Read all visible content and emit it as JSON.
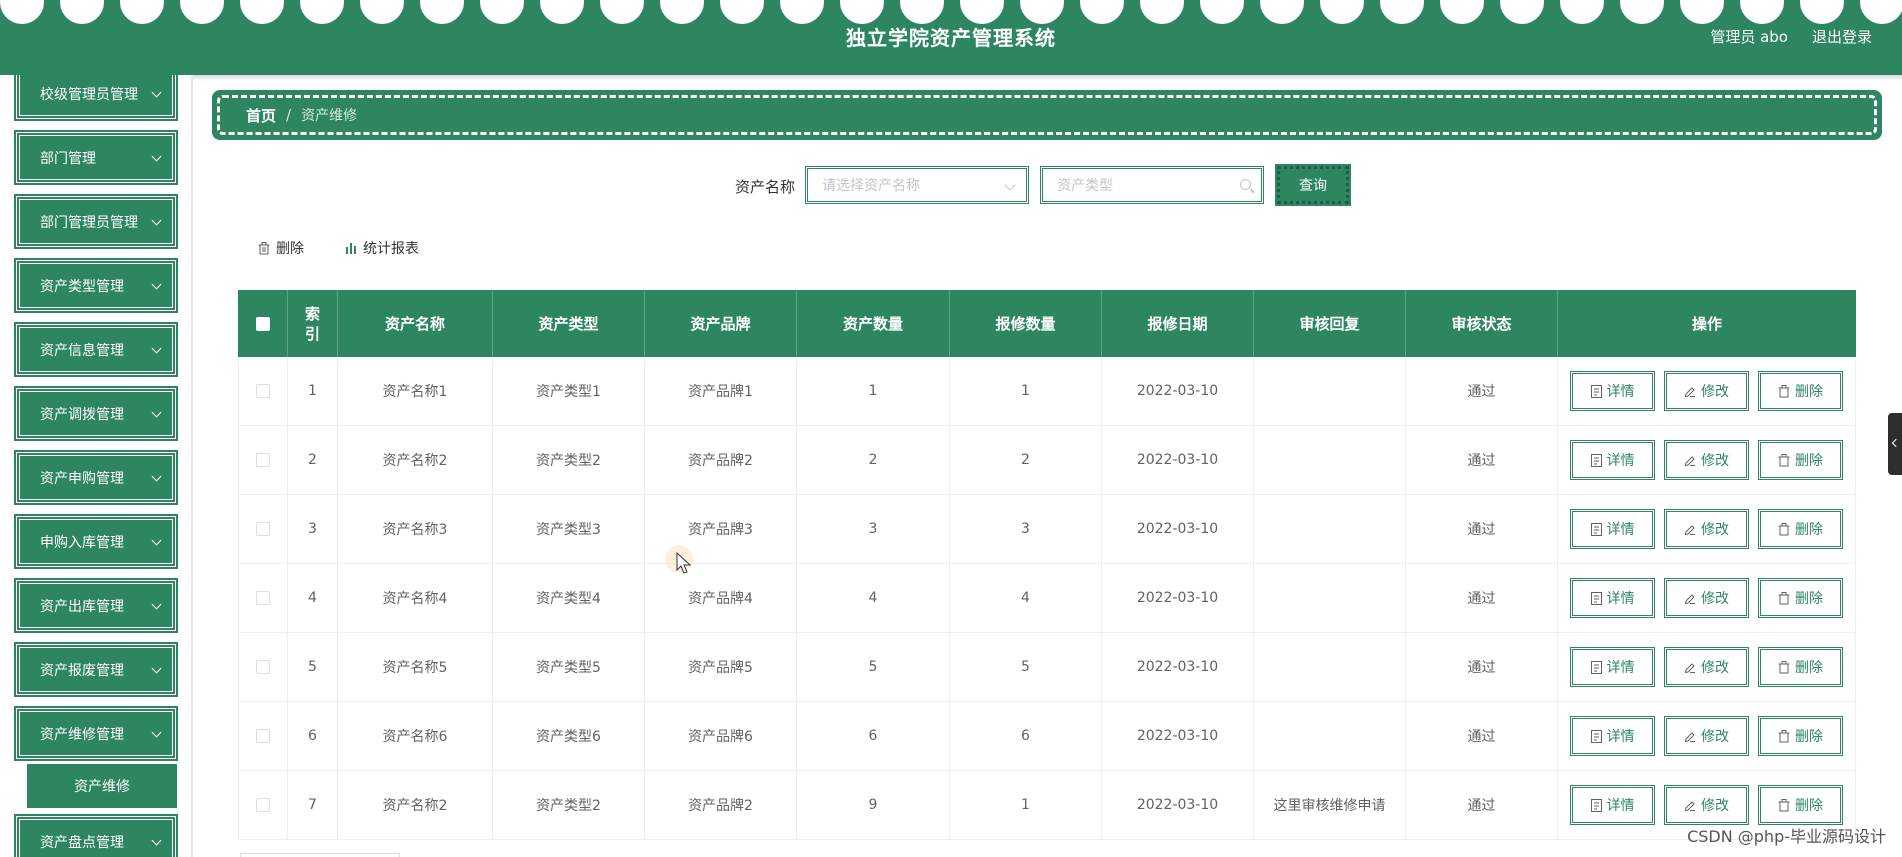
{
  "header": {
    "title": "独立学院资产管理系统",
    "user_label": "管理员 abo",
    "logout_label": "退出登录"
  },
  "sidebar": {
    "items": [
      {
        "label": "校级管理员管理"
      },
      {
        "label": "部门管理"
      },
      {
        "label": "部门管理员管理"
      },
      {
        "label": "资产类型管理"
      },
      {
        "label": "资产信息管理"
      },
      {
        "label": "资产调拨管理"
      },
      {
        "label": "资产申购管理"
      },
      {
        "label": "申购入库管理"
      },
      {
        "label": "资产出库管理"
      },
      {
        "label": "资产报废管理"
      },
      {
        "label": "资产维修管理"
      },
      {
        "label": "资产盘点管理"
      }
    ],
    "active_sub": "资产维修"
  },
  "breadcrumb": {
    "home": "首页",
    "separator": "/",
    "current": "资产维修"
  },
  "search": {
    "label": "资产名称",
    "name_placeholder": "请选择资产名称",
    "type_placeholder": "资产类型",
    "query_label": "查询"
  },
  "toolbar": {
    "delete_label": "删除",
    "report_label": "统计报表"
  },
  "table": {
    "headers": [
      "索引",
      "资产名称",
      "资产类型",
      "资产品牌",
      "资产数量",
      "报修数量",
      "报修日期",
      "审核回复",
      "审核状态",
      "操作"
    ],
    "rows": [
      {
        "idx": "1",
        "name": "资产名称1",
        "type": "资产类型1",
        "brand": "资产品牌1",
        "qty": "1",
        "rep": "1",
        "date": "2022-03-10",
        "reply": "",
        "status": "通过"
      },
      {
        "idx": "2",
        "name": "资产名称2",
        "type": "资产类型2",
        "brand": "资产品牌2",
        "qty": "2",
        "rep": "2",
        "date": "2022-03-10",
        "reply": "",
        "status": "通过"
      },
      {
        "idx": "3",
        "name": "资产名称3",
        "type": "资产类型3",
        "brand": "资产品牌3",
        "qty": "3",
        "rep": "3",
        "date": "2022-03-10",
        "reply": "",
        "status": "通过"
      },
      {
        "idx": "4",
        "name": "资产名称4",
        "type": "资产类型4",
        "brand": "资产品牌4",
        "qty": "4",
        "rep": "4",
        "date": "2022-03-10",
        "reply": "",
        "status": "通过"
      },
      {
        "idx": "5",
        "name": "资产名称5",
        "type": "资产类型5",
        "brand": "资产品牌5",
        "qty": "5",
        "rep": "5",
        "date": "2022-03-10",
        "reply": "",
        "status": "通过"
      },
      {
        "idx": "6",
        "name": "资产名称6",
        "type": "资产类型6",
        "brand": "资产品牌6",
        "qty": "6",
        "rep": "6",
        "date": "2022-03-10",
        "reply": "",
        "status": "通过"
      },
      {
        "idx": "7",
        "name": "资产名称2",
        "type": "资产类型2",
        "brand": "资产品牌2",
        "qty": "9",
        "rep": "1",
        "date": "2022-03-10",
        "reply": "这里审核维修申请",
        "status": "通过"
      }
    ],
    "ops": {
      "detail": "详情",
      "edit": "修改",
      "delete": "删除"
    }
  },
  "watermark": "CSDN @php-毕业源码设计",
  "colors": {
    "primary": "#2e8660",
    "header_bg": "#2e8660"
  }
}
